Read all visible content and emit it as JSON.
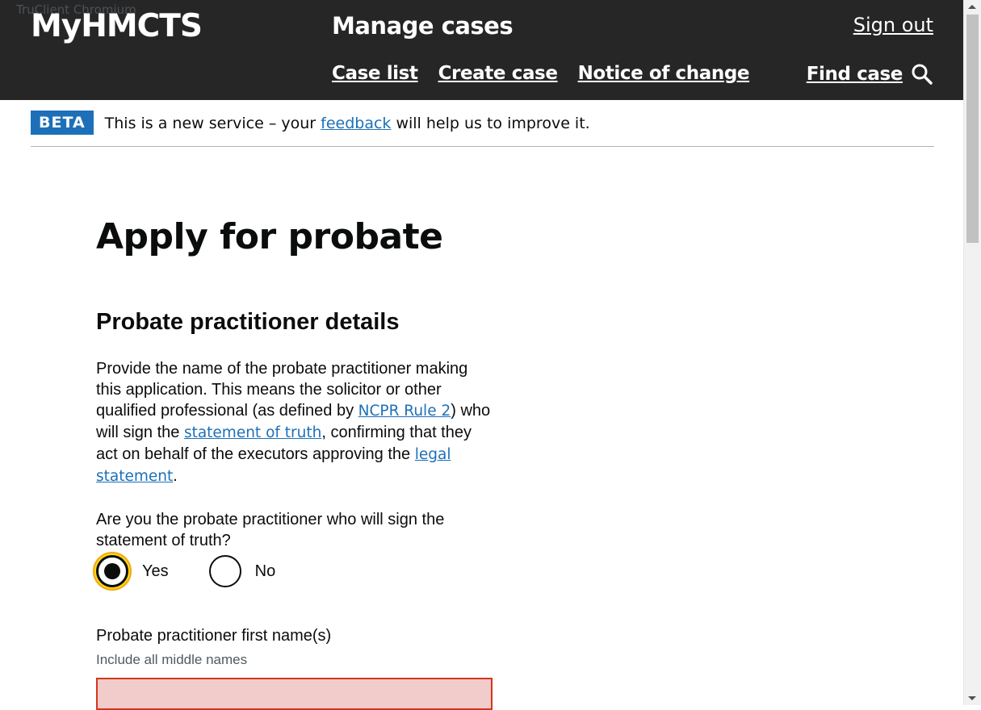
{
  "overlay": {
    "tru_client": "TruClient Chromium"
  },
  "header": {
    "logo": "MyHMCTS",
    "service_name": "Manage cases",
    "sign_out": "Sign out",
    "nav": [
      "Case list",
      "Create case",
      "Notice of change"
    ],
    "find_case": "Find case"
  },
  "phase_banner": {
    "tag": "BETA",
    "text_before": "This is a new service – your ",
    "link": "feedback",
    "text_after": " will help us to improve it."
  },
  "page": {
    "title": "Apply for probate",
    "section_heading": "Probate practitioner details",
    "intro": {
      "part1": "Provide the name of the probate practitioner making this application. This means the solicitor or other qualified professional (as defined by ",
      "link1": "NCPR Rule 2",
      "part2": ") who will sign the ",
      "link2": "statement of truth",
      "part3": ", confirming that they act on behalf of the executors approving the ",
      "link3": "legal statement",
      "part4": "."
    },
    "question": "Are you the probate practitioner who will sign the statement of truth?",
    "radios": [
      {
        "label": "Yes",
        "selected": true
      },
      {
        "label": "No",
        "selected": false
      }
    ],
    "first_name": {
      "label": "Probate practitioner first name(s)",
      "hint": "Include all middle names",
      "value": ""
    }
  },
  "colors": {
    "header_bg": "#262626",
    "link": "#1d70b8",
    "tag_bg": "#1d70b8",
    "focus": "#ffdd00",
    "error_border": "#d4351c",
    "error_input_bg": "#f2cbcb"
  },
  "icons": {
    "search": "search-icon"
  }
}
